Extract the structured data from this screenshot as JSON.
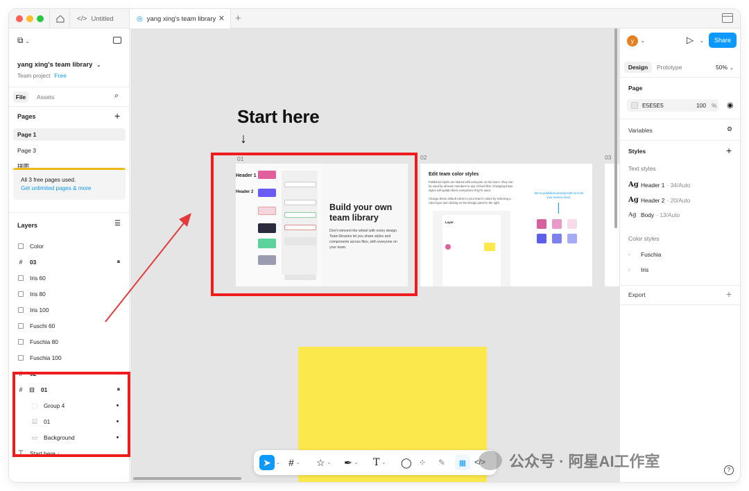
{
  "window": {
    "tabs": [
      {
        "label": "Untitled",
        "icon": "code-icon"
      },
      {
        "label": "yang xing's team library",
        "icon": "figma-file-icon"
      }
    ]
  },
  "left": {
    "team_name": "yang xing's team library",
    "project": "Team project",
    "plan_badge": "Free",
    "file_tab": "File",
    "assets_tab": "Assets",
    "pages_title": "Pages",
    "pages": [
      "Page 1",
      "Page 3",
      "拼图"
    ],
    "notice_line1": "All 3 free pages used.",
    "notice_link": "Get unlimited pages & more",
    "layers_title": "Layers",
    "layers": [
      {
        "name": "Color",
        "kind": "section",
        "bold": false
      },
      {
        "name": "03",
        "kind": "frame",
        "bold": true,
        "locked": true
      },
      {
        "name": "Iris 60",
        "kind": "section"
      },
      {
        "name": "Iris 80",
        "kind": "section"
      },
      {
        "name": "Iris 100",
        "kind": "section"
      },
      {
        "name": "Fuschi 60",
        "kind": "section"
      },
      {
        "name": "Fuschia 80",
        "kind": "section"
      },
      {
        "name": "Fuschia 100",
        "kind": "section"
      },
      {
        "name": "02",
        "kind": "frame",
        "bold": true,
        "locked": true
      },
      {
        "name": "01",
        "kind": "frame",
        "bold": true,
        "locked": true
      },
      {
        "name": "Group 4",
        "kind": "group"
      },
      {
        "name": "01",
        "kind": "component"
      },
      {
        "name": "Background",
        "kind": "rect"
      },
      {
        "name": "Start here ↓",
        "kind": "text"
      }
    ]
  },
  "canvas": {
    "start_title": "Start here",
    "start_arrow": "↓",
    "frame_labels": [
      "01",
      "02",
      "03"
    ],
    "frame1": {
      "heading": "Build your own team library",
      "body": "Don't reinvent the wheel with every design. Team libraries let you share styles and components across files, with everyone on your team."
    },
    "frame2": {
      "heading": "Edit team color styles",
      "body": "Published styles are shared with everyone on the team—they can be used by all team members in any of their files. Changing these styles will update them everywhere they're used.",
      "body2": "Change these default colors to your team's colors by selecting a color layer and clicking on the Design panel to the right.",
      "note": "We've published already! Edit so to be your team's colors."
    }
  },
  "right": {
    "avatar_initial": "y",
    "share_label": "Share",
    "design_tab": "Design",
    "prototype_tab": "Prototype",
    "zoom": "50%",
    "page_title": "Page",
    "page_color": "E5E5E5",
    "page_opacity": "100",
    "page_opacity_unit": "%",
    "variables": "Variables",
    "styles": "Styles",
    "text_styles": "Text styles",
    "text_style_items": [
      {
        "name": "Header 1",
        "detail": "· 34/Auto"
      },
      {
        "name": "Header 2",
        "detail": "· 20/Auto"
      },
      {
        "name": "Body",
        "detail": "· 13/Auto"
      }
    ],
    "color_styles": "Color styles",
    "color_style_items": [
      "Fuschia",
      "Iris"
    ],
    "export": "Export"
  },
  "colors": {
    "accent": "#0d99ff",
    "highlight_box": "#ee1c1c",
    "canvas_bg": "#e5e5e5",
    "sticky": "#fbe84d"
  },
  "watermark": "公众号 · 阿星AI工作室"
}
